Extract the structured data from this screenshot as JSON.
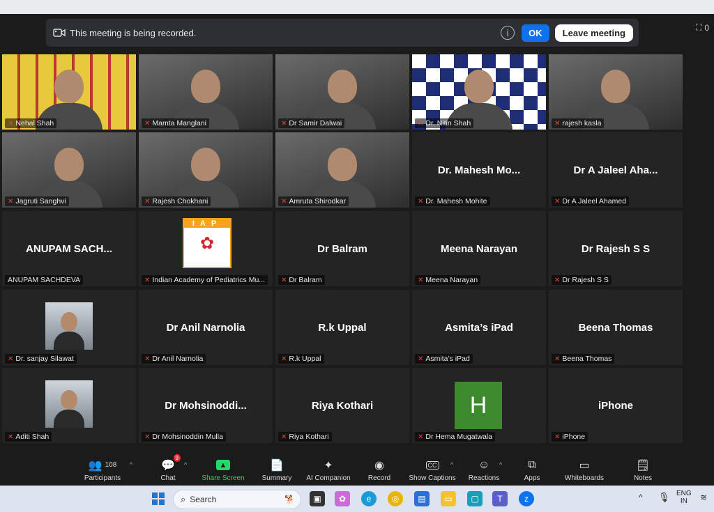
{
  "banner": {
    "recording_text": "This meeting is being recorded.",
    "ok_label": "OK",
    "leave_label": "Leave meeting"
  },
  "view_count": "0",
  "participants": [
    {
      "name": "Nehal Shah",
      "video": true,
      "active": true
    },
    {
      "name": "Mamta Manglani",
      "video": true
    },
    {
      "name": "Dr Samir Dalwai",
      "video": true
    },
    {
      "name": "Dr. Nitin Shah",
      "video": true
    },
    {
      "name": "rajesh kasla",
      "video": true
    },
    {
      "name": "Jagruti Sanghvi",
      "video": true
    },
    {
      "name": "Rajesh Chokhani",
      "video": true
    },
    {
      "name": "Amruta Shirodkar",
      "video": true
    },
    {
      "name": "Dr. Mahesh Mohite",
      "display": "Dr. Mahesh Mo..."
    },
    {
      "name": "Dr A Jaleel Ahamed",
      "display": "Dr A Jaleel Aha..."
    },
    {
      "name": "ANUPAM SACHDEVA",
      "display": "ANUPAM SACH...",
      "no_mic_icon": true
    },
    {
      "name": "Indian Academy of Pediatrics Mu...",
      "logo": "IAP"
    },
    {
      "name": "Dr Balram",
      "display": "Dr Balram"
    },
    {
      "name": "Meena Narayan",
      "display": "Meena Narayan"
    },
    {
      "name": "Dr Rajesh S S",
      "display": "Dr Rajesh S S"
    },
    {
      "name": "Dr. sanjay Silawat",
      "avatar": "photo"
    },
    {
      "name": "Dr Anil Narnolia",
      "display": "Dr Anil Narnolia"
    },
    {
      "name": "R.k Uppal",
      "display": "R.k Uppal"
    },
    {
      "name": "Asmita’s iPad",
      "display": "Asmita’s iPad"
    },
    {
      "name": "Beena Thomas",
      "display": "Beena Thomas"
    },
    {
      "name": "Aditi Shah",
      "avatar": "photo"
    },
    {
      "name": "Dr Mohsinoddin Mulla",
      "display": "Dr Mohsinoddi..."
    },
    {
      "name": "Riya Kothari",
      "display": "Riya Kothari"
    },
    {
      "name": "Dr Hema Mugatwala",
      "letter": "H"
    },
    {
      "name": "iPhone",
      "display": "iPhone"
    }
  ],
  "toolbar": {
    "participants_label": "Participants",
    "participants_count": "108",
    "chat_label": "Chat",
    "chat_badge": "9",
    "share_label": "Share Screen",
    "summary_label": "Summary",
    "ai_label": "AI Companion",
    "record_label": "Record",
    "captions_label": "Show Captions",
    "reactions_label": "Reactions",
    "apps_label": "Apps",
    "whiteboards_label": "Whiteboards",
    "notes_label": "Notes"
  },
  "taskbar": {
    "search_placeholder": "Search",
    "lang_top": "ENG",
    "lang_bottom": "IN"
  },
  "colors": {
    "accent_blue": "#0e72ed",
    "share_green": "#23d96a",
    "muted_red": "#e0473b",
    "hema_avatar": "#3d8a2e"
  }
}
